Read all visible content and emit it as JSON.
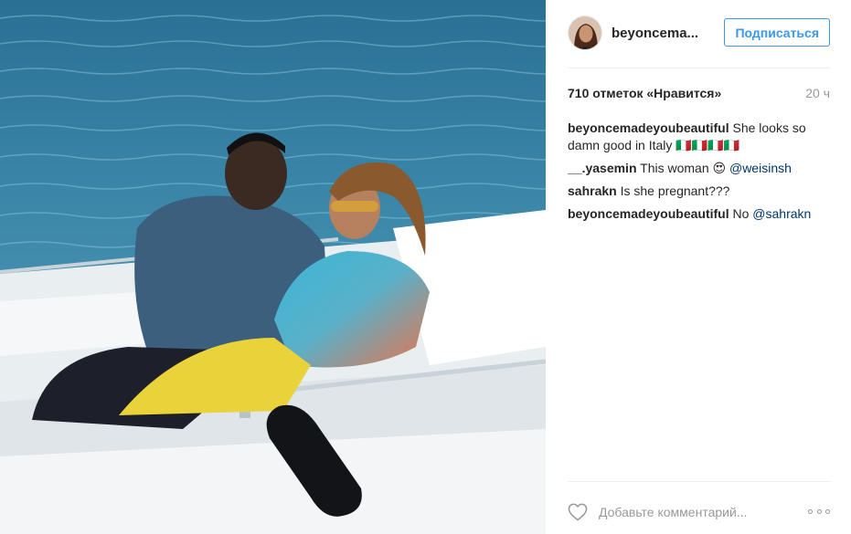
{
  "post": {
    "photo_icon": "photo-image"
  },
  "header": {
    "username": "beyoncema...",
    "follow_label": "Подписаться"
  },
  "stats": {
    "likes": "710 отметок «Нравится»",
    "time": "20 ч"
  },
  "comments": [
    {
      "user": "beyoncemadeyoubeautiful",
      "text": "She looks so damn good in Italy 🇮🇹🇮🇹🇮🇹🇮🇹",
      "mention": ""
    },
    {
      "user": "__.yasemin",
      "text": "This woman 😍",
      "mention": "@weisinsh"
    },
    {
      "user": "sahrakn",
      "text": "Is she pregnant???",
      "mention": ""
    },
    {
      "user": "beyoncemadeyoubeautiful",
      "text": "No",
      "mention": "@sahrakn"
    }
  ],
  "footer": {
    "comment_placeholder": "Добавьте комментарий...",
    "heart_icon": "heart-outline",
    "more_icon": "ellipsis"
  },
  "colors": {
    "accent": "#3897f0",
    "mention": "#003569",
    "muted": "#999999"
  }
}
